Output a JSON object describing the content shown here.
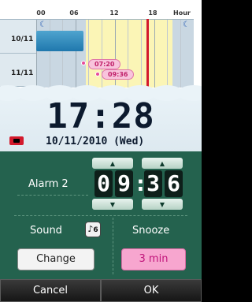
{
  "timeline": {
    "hour_labels": [
      "00",
      "06",
      "12",
      "18"
    ],
    "hour_unit": "Hour",
    "rows": [
      {
        "date_label": "10/11"
      },
      {
        "date_label": "11/11"
      }
    ],
    "alarm_pills": [
      "07:20",
      "09:36"
    ],
    "icons": {
      "sun": "sun-icon",
      "moon": "moon-icon"
    }
  },
  "clock": {
    "time": "17:28",
    "date": "10/11/2010 (Wed)"
  },
  "alarm": {
    "label": "Alarm 2",
    "hour_digits": [
      "0",
      "9"
    ],
    "minute_digits": [
      "3",
      "6"
    ],
    "colon": ":"
  },
  "sound": {
    "label": "Sound",
    "icon_text": "6",
    "change_label": "Change"
  },
  "snooze": {
    "label": "Snooze",
    "value": "3 min"
  },
  "footer": {
    "cancel_label": "Cancel",
    "ok_label": "OK"
  },
  "colors": {
    "bottom_bg": "#24624e",
    "now_line": "#d31a2c",
    "alarm_pill": "#f8c4dc",
    "snooze_button": "#f7a6cf"
  }
}
